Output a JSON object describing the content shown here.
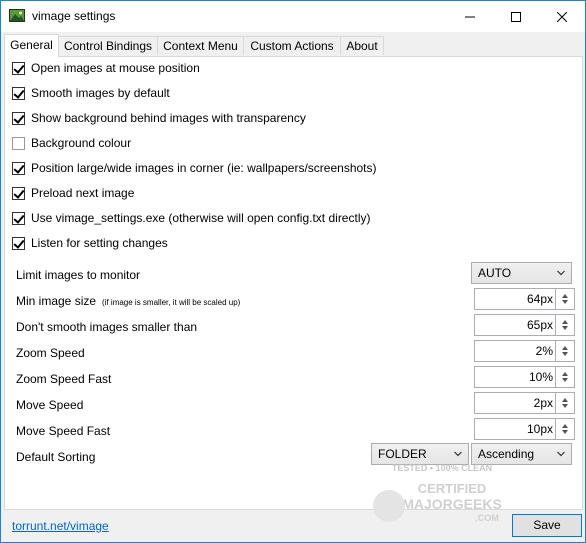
{
  "window": {
    "title": "vimage settings",
    "icon": "image-app-icon"
  },
  "tabs": [
    {
      "label": "General"
    },
    {
      "label": "Control Bindings"
    },
    {
      "label": "Context Menu"
    },
    {
      "label": "Custom Actions"
    },
    {
      "label": "About"
    }
  ],
  "checkboxes": [
    {
      "label": "Open images at mouse position",
      "checked": true
    },
    {
      "label": "Smooth images by default",
      "checked": true
    },
    {
      "label": "Show background behind images with transparency",
      "checked": true
    },
    {
      "label": "Background colour",
      "checked": false
    },
    {
      "label": "Position large/wide images in corner (ie: wallpapers/screenshots)",
      "checked": true
    },
    {
      "label": "Preload next image",
      "checked": true
    },
    {
      "label": "Use vimage_settings.exe (otherwise will open config.txt directly)",
      "checked": true
    },
    {
      "label": "Listen for setting changes",
      "checked": true
    }
  ],
  "settings": {
    "limit_monitor": {
      "label": "Limit images to monitor",
      "value": "AUTO"
    },
    "min_size": {
      "label": "Min image size",
      "hint": "(if image is smaller, it will be scaled up)",
      "value": "64px"
    },
    "no_smooth": {
      "label": "Don't smooth images smaller than",
      "value": "65px"
    },
    "zoom_speed": {
      "label": "Zoom Speed",
      "value": "2%"
    },
    "zoom_speed_fast": {
      "label": "Zoom Speed Fast",
      "value": "10%"
    },
    "move_speed": {
      "label": "Move Speed",
      "value": "2px"
    },
    "move_speed_fast": {
      "label": "Move Speed Fast",
      "value": "10px"
    },
    "default_sorting": {
      "label": "Default Sorting",
      "sort_by": "FOLDER",
      "order": "Ascending"
    }
  },
  "footer": {
    "link": "torrunt.net/vimage",
    "save_label": "Save"
  },
  "watermark": {
    "line1": "TESTED • 100% CLEAN",
    "line2": "CERTIFIED",
    "line3": "MAJORGEEKS",
    "line4": ".COM"
  }
}
